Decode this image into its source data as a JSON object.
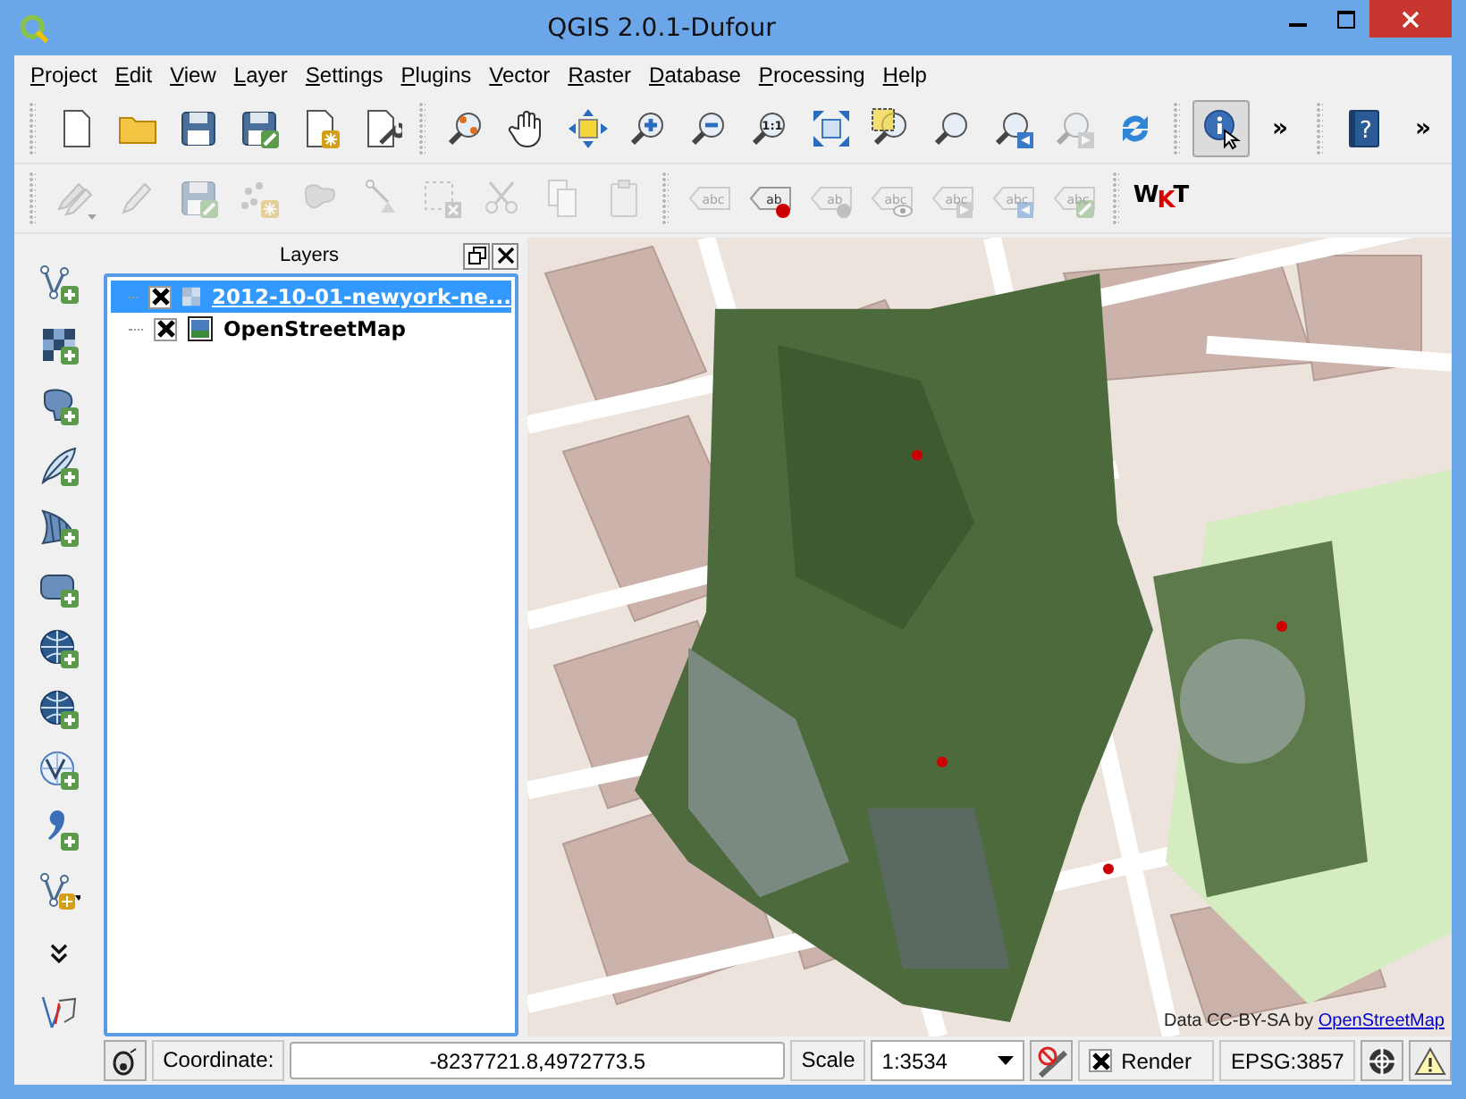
{
  "window": {
    "title": "QGIS 2.0.1-Dufour"
  },
  "menu": [
    "Project",
    "Edit",
    "View",
    "Layer",
    "Settings",
    "Plugins",
    "Vector",
    "Raster",
    "Database",
    "Processing",
    "Help"
  ],
  "toolbar_main": [
    {
      "tools": [
        {
          "kind": "new",
          "selected": false,
          "disabled": false
        },
        {
          "kind": "open",
          "selected": false,
          "disabled": false
        },
        {
          "kind": "save",
          "selected": false,
          "disabled": false
        },
        {
          "kind": "saveas",
          "selected": false,
          "disabled": false
        },
        {
          "kind": "newcomposer",
          "selected": false,
          "disabled": false
        },
        {
          "kind": "composers",
          "selected": false,
          "disabled": false
        }
      ]
    },
    {
      "tools": [
        {
          "kind": "pantoselection",
          "selected": false,
          "disabled": false
        },
        {
          "kind": "pan",
          "selected": false,
          "disabled": false
        },
        {
          "kind": "touch",
          "selected": false,
          "disabled": false
        },
        {
          "kind": "zoomin",
          "selected": false,
          "disabled": false
        },
        {
          "kind": "zoomout",
          "selected": false,
          "disabled": false
        },
        {
          "kind": "zoomnative",
          "glyph": "1:1",
          "selected": false,
          "disabled": false
        },
        {
          "kind": "zoomfull",
          "selected": false,
          "disabled": false
        },
        {
          "kind": "zoomselection",
          "selected": false,
          "disabled": false
        },
        {
          "kind": "zoomlayer",
          "selected": false,
          "disabled": false
        },
        {
          "kind": "zoomlast",
          "selected": false,
          "disabled": false
        },
        {
          "kind": "zoomnext",
          "selected": false,
          "disabled": true
        },
        {
          "kind": "refresh",
          "selected": false,
          "disabled": false
        }
      ]
    },
    {
      "tools": [
        {
          "kind": "identify",
          "selected": true,
          "disabled": false
        }
      ],
      "overflow": "»"
    },
    {
      "tools": [
        {
          "kind": "help",
          "glyph": "?",
          "selected": false,
          "disabled": false
        }
      ],
      "overflow": "»"
    }
  ],
  "toolbar_edit": [
    {
      "tools": [
        {
          "kind": "edits",
          "disabled": true
        },
        {
          "kind": "toggleedit",
          "disabled": true
        },
        {
          "kind": "savelayer",
          "disabled": true
        },
        {
          "kind": "addfeature",
          "disabled": true
        },
        {
          "kind": "movefeature",
          "disabled": true
        },
        {
          "kind": "nodetool",
          "disabled": true
        },
        {
          "kind": "deleteselected",
          "disabled": true
        },
        {
          "kind": "cut",
          "disabled": true
        },
        {
          "kind": "copy",
          "disabled": true
        },
        {
          "kind": "paste",
          "disabled": true
        }
      ]
    },
    {
      "tools": [
        {
          "kind": "labeling",
          "glyph": "abc",
          "disabled": true
        },
        {
          "kind": "labelhighlight",
          "glyph": "ab",
          "disabled": false
        },
        {
          "kind": "labelpin",
          "glyph": "ab",
          "disabled": true
        },
        {
          "kind": "labelshow",
          "glyph": "abc",
          "disabled": true
        },
        {
          "kind": "labelmove",
          "glyph": "abc",
          "disabled": true
        },
        {
          "kind": "labelrotate",
          "glyph": "abc",
          "disabled": true
        },
        {
          "kind": "labeledit",
          "glyph": "abc",
          "disabled": true
        }
      ]
    },
    {
      "tools": [
        {
          "kind": "wkt",
          "glyph": "WKT",
          "disabled": false
        }
      ]
    }
  ],
  "toolbar_layers": [
    {
      "kind": "addvector"
    },
    {
      "kind": "addraster"
    },
    {
      "kind": "addpostgis"
    },
    {
      "kind": "addspatialite"
    },
    {
      "kind": "addmssql"
    },
    {
      "kind": "addoracle"
    },
    {
      "kind": "addwms"
    },
    {
      "kind": "addwcs"
    },
    {
      "kind": "addwfs"
    },
    {
      "kind": "adddelimited"
    },
    {
      "kind": "newlayer"
    },
    {
      "kind": "more"
    },
    {
      "kind": "digitize"
    }
  ],
  "layers": {
    "title": "Layers",
    "items": [
      {
        "name": "2012-10-01-newyork-ne...",
        "kind": "raster",
        "checked": true,
        "selected": true
      },
      {
        "name": "OpenStreetMap",
        "kind": "image",
        "checked": true,
        "selected": false
      }
    ]
  },
  "map": {
    "attribution": "Data CC-BY-SA by",
    "attribution_link": "OpenStreetMap"
  },
  "status_bar": {
    "coordinate_label": "Coordinate:",
    "coordinate": "-8237721.8,4972773.5",
    "scale_label": "Scale",
    "scale": "1:3534",
    "render_label": "Render",
    "render": true,
    "crs": "EPSG:3857"
  }
}
